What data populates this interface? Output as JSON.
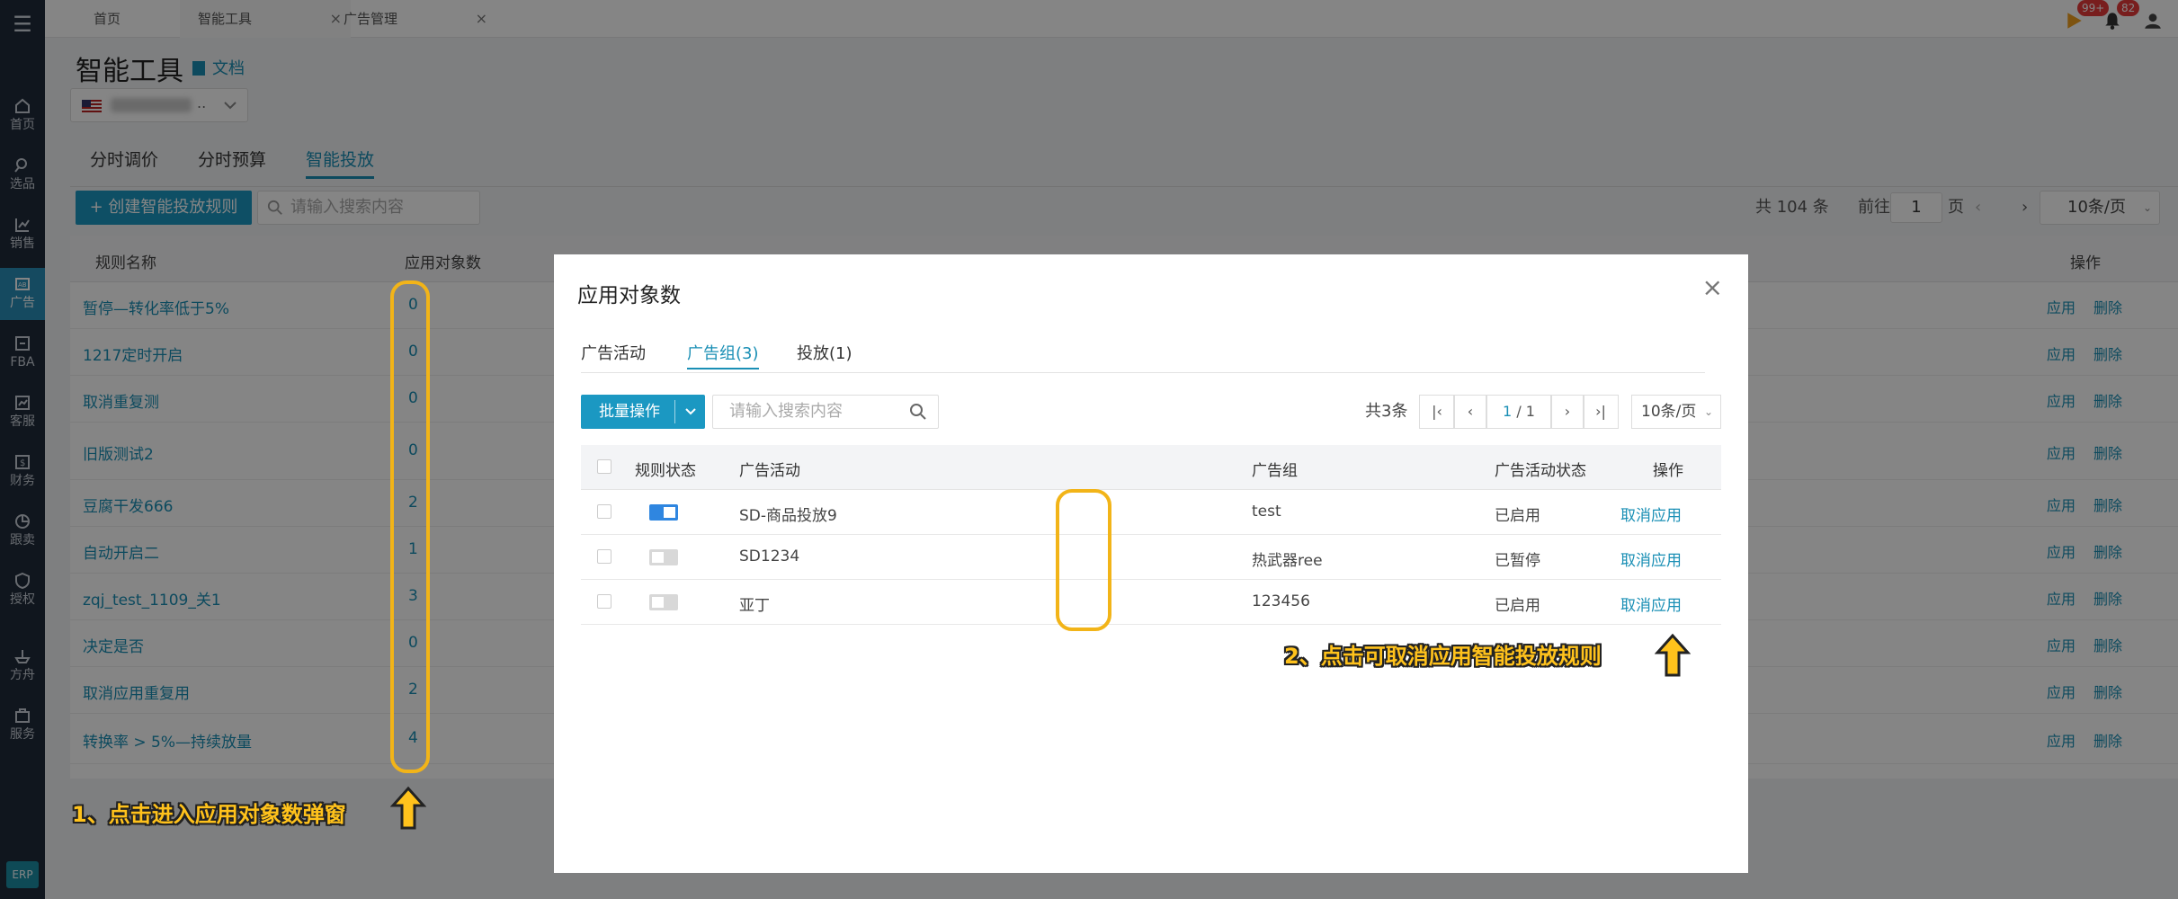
{
  "sidebar": {
    "items": [
      {
        "label": "首页",
        "icon": "home-icon"
      },
      {
        "label": "选品",
        "icon": "search-icon"
      },
      {
        "label": "销售",
        "icon": "chart-icon"
      },
      {
        "label": "广告",
        "icon": "ad-icon"
      },
      {
        "label": "FBA",
        "icon": "fba-icon"
      },
      {
        "label": "客服",
        "icon": "service-icon"
      },
      {
        "label": "财务",
        "icon": "finance-icon"
      },
      {
        "label": "跟卖",
        "icon": "pie-icon"
      },
      {
        "label": "授权",
        "icon": "shield-icon"
      },
      {
        "label": "方舟",
        "icon": "ark-icon"
      },
      {
        "label": "服务",
        "icon": "building-icon"
      }
    ],
    "erp": "ERP"
  },
  "topbar": {
    "tabs": [
      {
        "label": "首页"
      },
      {
        "label": "智能工具"
      },
      {
        "label": "广告管理"
      }
    ],
    "badge_notify": "99+",
    "badge_bell": "82",
    "close_glyph": "×"
  },
  "page": {
    "title": "智能工具",
    "doc_link": "文档",
    "store_suffix": "..",
    "subtabs": [
      "分时调价",
      "分时预算",
      "智能投放"
    ],
    "create_button": "+ 创建智能投放规则",
    "search_placeholder": "请输入搜索内容",
    "total": "共 104 条",
    "goto": "前往",
    "page_value": "1",
    "page_unit": "页",
    "per_page": "10条/页"
  },
  "main_table": {
    "headers": {
      "name": "规则名称",
      "count": "应用对象数",
      "ops": "操作"
    },
    "rows": [
      {
        "name": "暂停—转化率低于5%",
        "count": "0"
      },
      {
        "name": "1217定时开启",
        "count": "0"
      },
      {
        "name": "取消重复测",
        "count": "0"
      },
      {
        "name": "旧版测试2",
        "count": "0"
      },
      {
        "name": "豆腐干发666",
        "count": "2"
      },
      {
        "name": "自动开启二",
        "count": "1"
      },
      {
        "name": "zqj_test_1109_关1",
        "count": "3"
      },
      {
        "name": "决定是否",
        "count": "0"
      },
      {
        "name": "取消应用重复用",
        "count": "2"
      },
      {
        "name": "转换率 > 5%—持续放量",
        "count": "4"
      }
    ],
    "op_apply": "应用",
    "op_delete": "删除"
  },
  "modal": {
    "title": "应用对象数",
    "close": "×",
    "tabs": [
      "广告活动",
      "广告组(3)",
      "投放(1)"
    ],
    "batch": "批量操作",
    "search_placeholder": "请输入搜索内容",
    "total": "共3条",
    "page_current": "1",
    "page_total": "/ 1",
    "per_page": "10条/页",
    "headers": [
      "规则状态",
      "广告活动",
      "广告组",
      "广告活动状态",
      "操作"
    ],
    "rows": [
      {
        "on": true,
        "campaign": "SD-商品投放9",
        "group": "test",
        "status": "已启用",
        "action": "取消应用"
      },
      {
        "on": false,
        "campaign": "SD1234",
        "group": "热武器ree",
        "status": "已暂停",
        "action": "取消应用"
      },
      {
        "on": false,
        "campaign": "亚丁",
        "group": "123456",
        "status": "已启用",
        "action": "取消应用"
      }
    ]
  },
  "annotations": {
    "step1": "1、点击进入应用对象数弹窗",
    "step2": "2、点击可取消应用智能投放规则",
    "color": "#f2b418"
  },
  "colors": {
    "accent": "#1a8fb5",
    "sidebar": "#1f2b3a",
    "switch_on": "#2f86e0"
  }
}
